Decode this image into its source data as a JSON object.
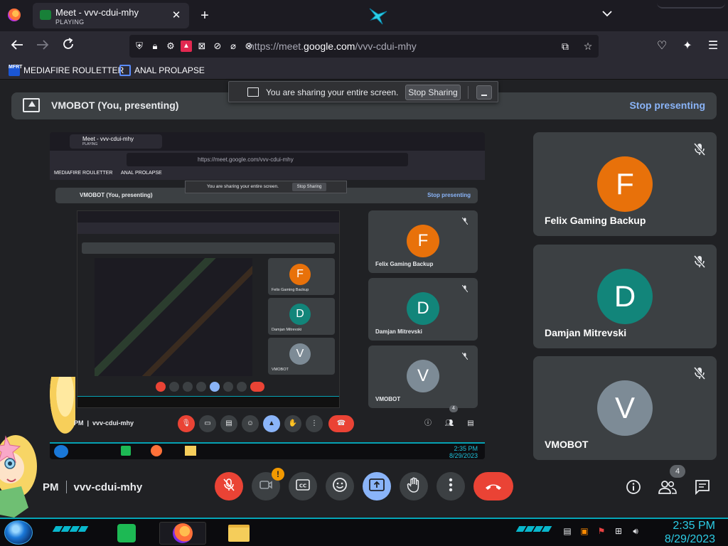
{
  "browser": {
    "tab_title": "Meet - vvv-cdui-mhy",
    "tab_status": "PLAYING",
    "tab_close": "✕",
    "new_tab": "+",
    "url_prefix": "https://meet.",
    "url_domain": "google.com",
    "url_path": "/vvv-cdui-mhy"
  },
  "bookmarks": [
    {
      "label": "MEDIAFIRE ROULETTER",
      "icon_text": "MFRT"
    },
    {
      "label": "ANAL PROLAPSE"
    }
  ],
  "share_banner": {
    "text": "You are sharing your entire screen.",
    "stop_label": "Stop Sharing"
  },
  "presenting": {
    "title": "VMOBOT (You, presenting)",
    "stop_label": "Stop presenting"
  },
  "participants": [
    {
      "initial": "F",
      "name": "Felix Gaming Backup",
      "color": "#e8710a"
    },
    {
      "initial": "D",
      "name": "Damjan Mitrevski",
      "color": "#12857a"
    },
    {
      "initial": "V",
      "name": "VMOBOT",
      "color": "#7d8b96"
    }
  ],
  "meeting": {
    "time": "PM",
    "code": "vvv-cdui-mhy",
    "people_count": "4",
    "camera_alert": "!"
  },
  "taskbar": {
    "time": "2:35 PM",
    "date": "8/29/2023"
  },
  "preview": {
    "people_count": "4",
    "time": "2:35 PM",
    "date": "8/29/2023",
    "inner_mediafire": "MEDIAFIRE ROULETTER",
    "inner_prolapse": "ANAL PROLAPSE"
  }
}
